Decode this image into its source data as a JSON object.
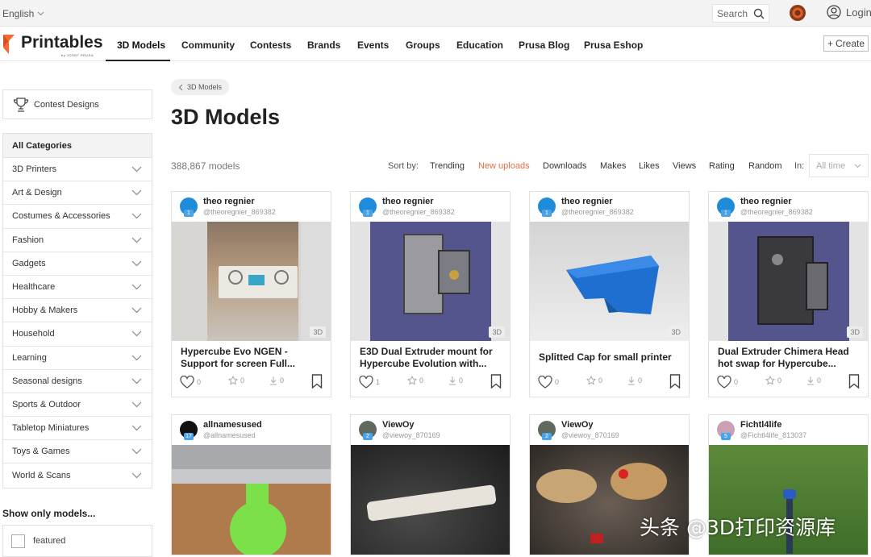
{
  "topbar": {
    "language": "English",
    "search_label": "Search",
    "login_label": "Login"
  },
  "nav": {
    "logo_text": "Printables",
    "logo_sub": "by JOSEF PRUSA",
    "links": [
      "3D Models",
      "Community",
      "Contests",
      "Brands",
      "Events",
      "Groups",
      "Education",
      "Prusa Blog",
      "Prusa Eshop"
    ],
    "active": "3D Models",
    "create_label": "Create"
  },
  "sidebar": {
    "contest_button": "Contest Designs",
    "categories_header": "All Categories",
    "categories": [
      "3D Printers",
      "Art & Design",
      "Costumes & Accessories",
      "Fashion",
      "Gadgets",
      "Healthcare",
      "Hobby & Makers",
      "Household",
      "Learning",
      "Seasonal designs",
      "Sports & Outdoor",
      "Tabletop Miniatures",
      "Toys & Games",
      "World & Scans"
    ],
    "show_only_title": "Show only models...",
    "featured_label": "featured"
  },
  "main": {
    "breadcrumb": "3D Models",
    "title": "3D Models",
    "count": "388,867 models",
    "sort_label": "Sort by:",
    "sort_options": [
      "Trending",
      "New uploads",
      "Downloads",
      "Makes",
      "Likes",
      "Views",
      "Rating",
      "Random"
    ],
    "sort_selected": "New uploads",
    "in_label": "In:",
    "time_filter": "All time"
  },
  "cards": [
    {
      "author": "theo regnier",
      "handle": "@theoregnier_869382",
      "badge": "1",
      "title": "Hypercube Evo NGEN - Support for screen Full...",
      "tag": "3D",
      "likes": "0",
      "ratings": "0",
      "downloads": "0"
    },
    {
      "author": "theo regnier",
      "handle": "@theoregnier_869382",
      "badge": "1",
      "title": "E3D Dual Extruder mount for Hypercube Evolution with...",
      "tag": "3D",
      "likes": "1",
      "ratings": "0",
      "downloads": "0"
    },
    {
      "author": "theo regnier",
      "handle": "@theoregnier_869382",
      "badge": "1",
      "title": "Splitted Cap for small printer",
      "tag": "3D",
      "likes": "0",
      "ratings": "0",
      "downloads": "0"
    },
    {
      "author": "theo regnier",
      "handle": "@theoregnier_869382",
      "badge": "1",
      "title": "Dual Extruder Chimera Head hot swap for Hypercube...",
      "tag": "3D",
      "likes": "0",
      "ratings": "0",
      "downloads": "0"
    },
    {
      "author": "allnamesused",
      "handle": "@allnamesused",
      "badge": "17"
    },
    {
      "author": "ViewOy",
      "handle": "@viewoy_870169",
      "badge": "2"
    },
    {
      "author": "ViewOy",
      "handle": "@viewoy_870169",
      "badge": "2"
    },
    {
      "author": "Fichtl4life",
      "handle": "@Fichtl4life_813037",
      "badge": "5"
    }
  ],
  "watermark": "头条 @3D打印资源库"
}
